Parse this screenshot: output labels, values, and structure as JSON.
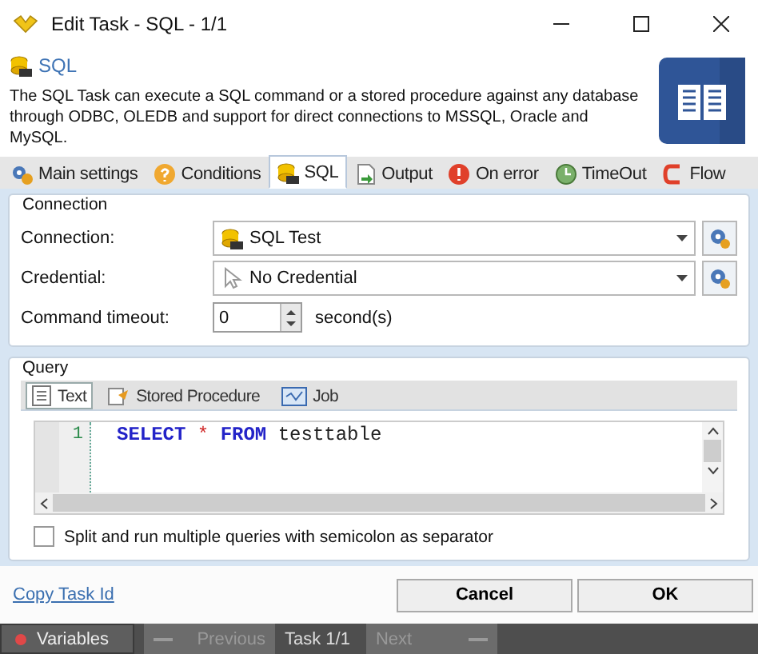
{
  "window": {
    "title": "Edit Task - SQL - 1/1"
  },
  "header": {
    "title": "SQL",
    "description": "The SQL Task can execute a SQL command or a stored procedure against any database through ODBC, OLEDB and support for direct connections to MSSQL, Oracle and MySQL."
  },
  "tabs": [
    {
      "label": "Main settings",
      "kind": "gears",
      "selected": false
    },
    {
      "label": "Conditions",
      "kind": "question",
      "selected": false
    },
    {
      "label": "SQL",
      "kind": "sql",
      "selected": true
    },
    {
      "label": "Output",
      "kind": "output",
      "selected": false
    },
    {
      "label": "On error",
      "kind": "error",
      "selected": false
    },
    {
      "label": "TimeOut",
      "kind": "clock",
      "selected": false
    },
    {
      "label": "Flow",
      "kind": "flow",
      "selected": false
    }
  ],
  "connection": {
    "title": "Connection",
    "fields": [
      {
        "label": "Connection:",
        "kind": "sql",
        "value": "SQL Test"
      },
      {
        "label": "Credential:",
        "kind": "pointer",
        "value": "No Credential"
      }
    ],
    "timeout": {
      "label": "Command timeout:",
      "value": "0",
      "unit": "second(s)"
    }
  },
  "query": {
    "title": "Query",
    "tabs": [
      {
        "label": "Text",
        "kind": "text",
        "selected": true
      },
      {
        "label": "Stored Procedure",
        "kind": "procedure",
        "selected": false
      },
      {
        "label": "Job",
        "kind": "job",
        "selected": false
      }
    ],
    "lines": [
      {
        "number": "1",
        "tokens": [
          {
            "kind": "keyword",
            "text": "SELECT"
          },
          {
            "kind": "operator",
            "text": "*"
          },
          {
            "kind": "keyword",
            "text": "FROM"
          },
          {
            "kind": "plain",
            "text": "testtable"
          }
        ]
      }
    ],
    "split": {
      "label": "Split and run multiple queries with semicolon as separator",
      "checked": false
    }
  },
  "footer": {
    "link": "Copy Task Id",
    "buttons": [
      "Cancel",
      "OK"
    ]
  },
  "bottom_bar": {
    "variables": "Variables",
    "previous": {
      "label": "Previous",
      "disabled": true
    },
    "position": "Task 1/1",
    "next": {
      "label": "Next",
      "disabled": true
    }
  }
}
